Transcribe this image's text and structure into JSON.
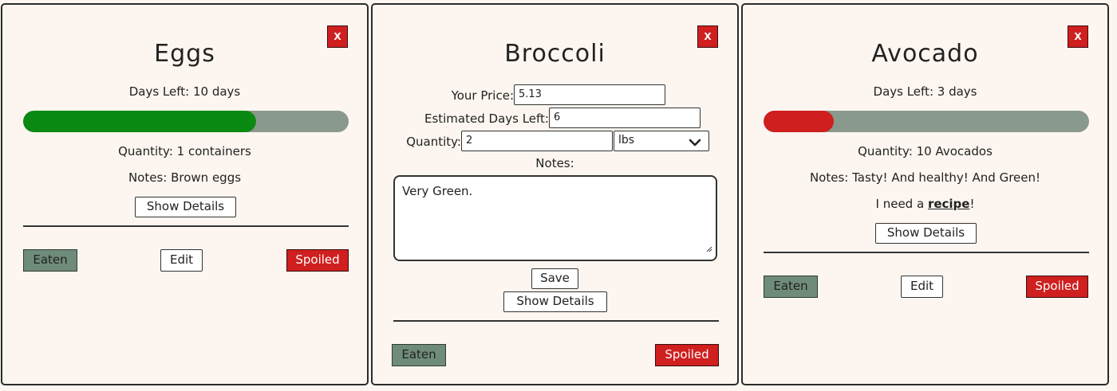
{
  "cards": [
    {
      "title": "Eggs",
      "close_label": "X",
      "days_left_label": "Days Left: 10 days",
      "freshness_fraction": 0.715,
      "freshness_color": "#0a8a12",
      "quantity": "Quantity: 1 containers",
      "notes": "Notes: Brown eggs",
      "show_details_label": "Show Details",
      "eaten_label": "Eaten",
      "edit_label": "Edit",
      "spoiled_label": "Spoiled"
    },
    {
      "title": "Broccoli",
      "close_label": "X",
      "form": {
        "price_label": "Your Price:",
        "price_value": "5.13",
        "days_label": "Estimated Days Left:",
        "days_value": "6",
        "quantity_label": "Quantity:",
        "quantity_value": "2",
        "unit_selected": "lbs",
        "notes_label": "Notes:",
        "notes_value": "Very Green.",
        "save_label": "Save"
      },
      "show_details_label": "Show Details",
      "eaten_label": "Eaten",
      "spoiled_label": "Spoiled"
    },
    {
      "title": "Avocado",
      "close_label": "X",
      "days_left_label": "Days Left: 3 days",
      "freshness_fraction": 0.215,
      "freshness_color": "#cf1f1f",
      "quantity": "Quantity: 10 Avocados",
      "notes": "Notes: Tasty! And healthy! And Green!",
      "recipe_prefix": "I need a ",
      "recipe_link": "recipe",
      "recipe_suffix": "!",
      "show_details_label": "Show Details",
      "eaten_label": "Eaten",
      "edit_label": "Edit",
      "spoiled_label": "Spoiled"
    }
  ],
  "icons": {
    "chevron": "chevron-down-icon",
    "resize": "resize-grip-icon"
  }
}
